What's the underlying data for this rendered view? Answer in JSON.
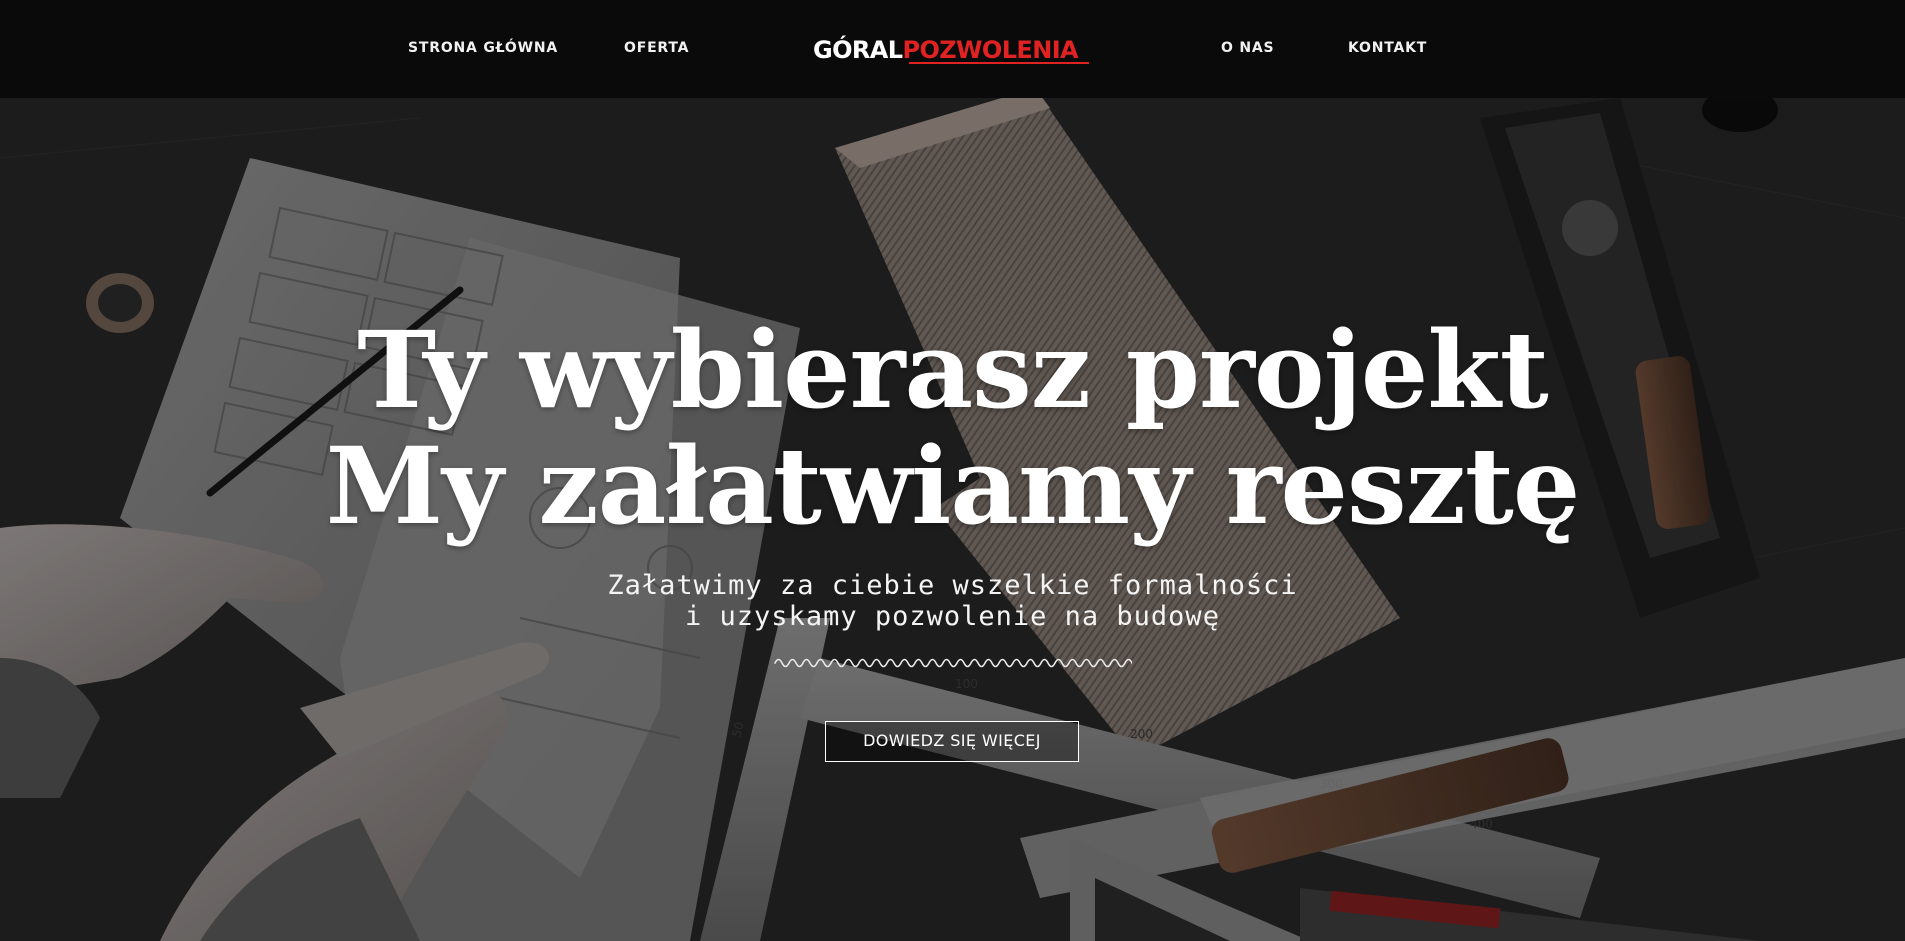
{
  "header": {
    "nav": {
      "home": "STRONA GŁÓWNA",
      "offer": "OFERTA",
      "about": "O NAS",
      "contact": "KONTAKT"
    },
    "logo": {
      "part1": "GÓRAL",
      "part2": "POZWOLENIA"
    }
  },
  "hero": {
    "headline_line1": "Ty wybierasz projekt",
    "headline_line2": "My załatwiamy resztę",
    "subtitle_line1": "Załatwimy za ciebie wszelkie formalności",
    "subtitle_line2": "i uzyskamy pozwolenie na budowę",
    "cta_label": "DOWIEDZ SIĘ WIĘCEJ",
    "background_image": "workbench-with-plans-and-tools",
    "divider_icon": "wavy-line-icon"
  },
  "colors": {
    "header_bg": "#0a0a0a",
    "brand_red": "#e02222",
    "text_white": "#ffffff"
  }
}
